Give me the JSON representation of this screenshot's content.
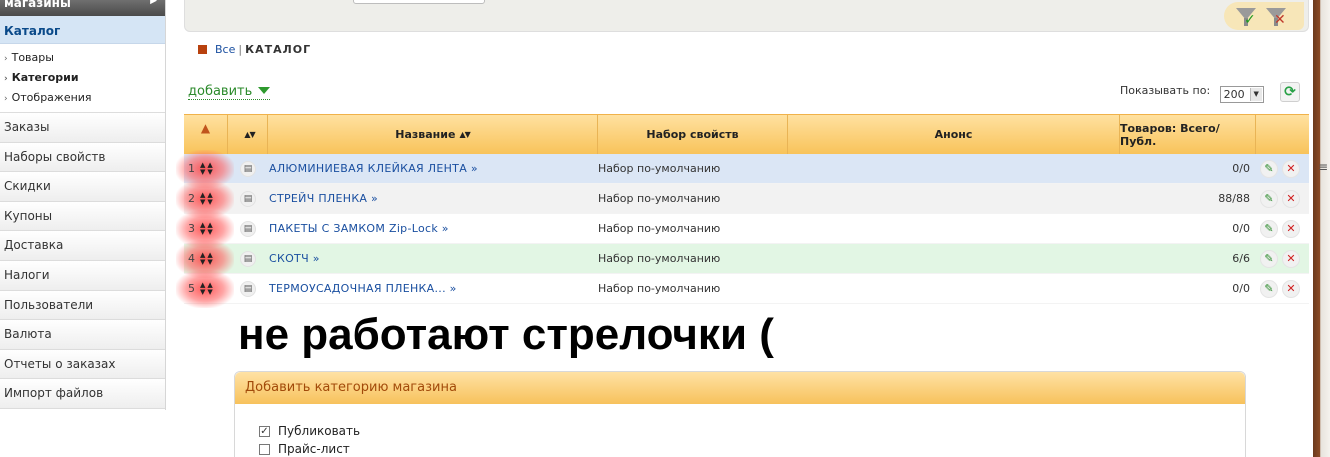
{
  "sidebar": {
    "top_label": "магазины",
    "active_section": "Каталог",
    "sub_items": [
      {
        "label": "Товары",
        "bold": false
      },
      {
        "label": "Категории",
        "bold": true
      },
      {
        "label": "Отображения",
        "bold": false
      }
    ],
    "items": [
      "Заказы",
      "Наборы свойств",
      "Скидки",
      "Купоны",
      "Доставка",
      "Налоги",
      "Пользователи",
      "Валюта",
      "Отчеты о заказах",
      "Импорт файлов"
    ]
  },
  "breadcrumb": {
    "root": "Все",
    "separator": "|",
    "current": "КАТАЛОГ"
  },
  "toolbar": {
    "add_label": "добавить",
    "per_page_label": "Показывать по:",
    "per_page_value": "200"
  },
  "table": {
    "headers": {
      "name": "Название",
      "property_set": "Набор свойств",
      "announce": "Анонс",
      "count": "Товаров: Всего/Публ."
    },
    "rows": [
      {
        "num": "1",
        "name": "АЛЮМИНИЕВАЯ КЛЕЙКАЯ ЛЕНТА »",
        "set": "Набор по-умолчанию",
        "announce": "",
        "count": "0/0"
      },
      {
        "num": "2",
        "name": "СТРЕЙЧ ПЛЕНКА »",
        "set": "Набор по-умолчанию",
        "announce": "",
        "count": "88/88"
      },
      {
        "num": "3",
        "name": "ПАКЕТЫ С ЗАМКОМ Zip-Lock »",
        "set": "Набор по-умолчанию",
        "announce": "",
        "count": "0/0"
      },
      {
        "num": "4",
        "name": "СКОТЧ »",
        "set": "Набор по-умолчанию",
        "announce": "",
        "count": "6/6"
      },
      {
        "num": "5",
        "name": "ТЕРМОУСАДОЧНАЯ ПЛЕНКА... »",
        "set": "Набор по-умолчанию",
        "announce": "",
        "count": "0/0"
      }
    ]
  },
  "caption": "не работают стрелочки (",
  "add_panel": {
    "title": "Добавить категорию магазина",
    "options": [
      {
        "label": "Публиковать",
        "checked": true
      },
      {
        "label": "Прайс-лист",
        "checked": false
      }
    ]
  },
  "colors": {
    "accent_orange": "#f8c35a",
    "link_blue": "#1a4fa0",
    "add_green": "#2b8a2b",
    "highlight_red": "#ff3c3c"
  },
  "icons": [
    "filter-apply-icon",
    "filter-clear-icon",
    "refresh-icon",
    "document-icon",
    "edit-icon",
    "delete-icon",
    "sort-arrows-icon"
  ]
}
